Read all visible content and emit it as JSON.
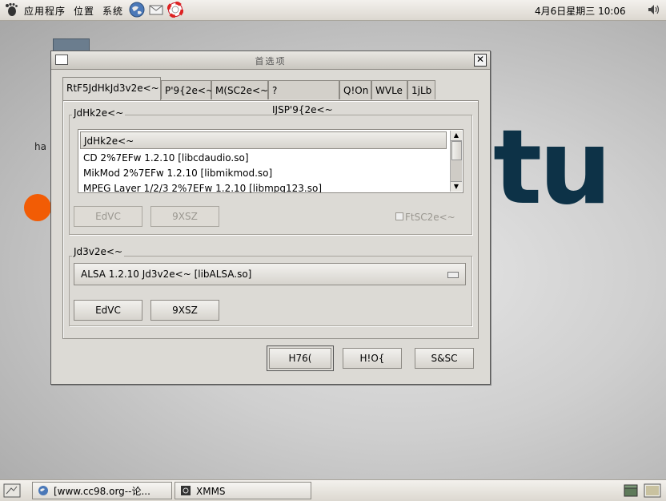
{
  "top_panel": {
    "menus": [
      "应用程序",
      "位置",
      "系统"
    ],
    "clock": "4月6日星期三 10:06",
    "launchers": [
      "web-browser-icon",
      "email-icon",
      "help-icon"
    ]
  },
  "desktop": {
    "partial_label": "ha",
    "logo_text": "tu"
  },
  "dialog": {
    "title": "首选项",
    "tabs": [
      "RtF5JdHkJd3v2e<~",
      "P'9{2e<~",
      "M(SC2e<~",
      "?IJSP'9{2e<~",
      "Q!On",
      "WVLe",
      "1jLb"
    ],
    "input_group": {
      "label": "JdHk2e<~",
      "list_header": "JdHk2e<~",
      "items": [
        "CD 2%7EFw 1.2.10  [libcdaudio.so]",
        "MikMod 2%7EFw 1.2.10  [libmikmod.so]",
        "MPEG Layer 1/2/3 2%7EFw 1.2.10  [libmpg123.so]"
      ],
      "config_btn": "EdVC",
      "about_btn": "9XSZ",
      "checkbox_label": "FtSC2e<~"
    },
    "output_group": {
      "label": "Jd3v2e<~",
      "selected": "ALSA 1.2.10 Jd3v2e<~  [libALSA.so]",
      "config_btn": "EdVC",
      "about_btn": "9XSZ"
    },
    "buttons": {
      "ok": "H76(",
      "cancel": "H!O{",
      "apply": "S&SC"
    }
  },
  "taskbar": {
    "tasks": [
      "[www.cc98.org--论...",
      "XMMS"
    ]
  }
}
